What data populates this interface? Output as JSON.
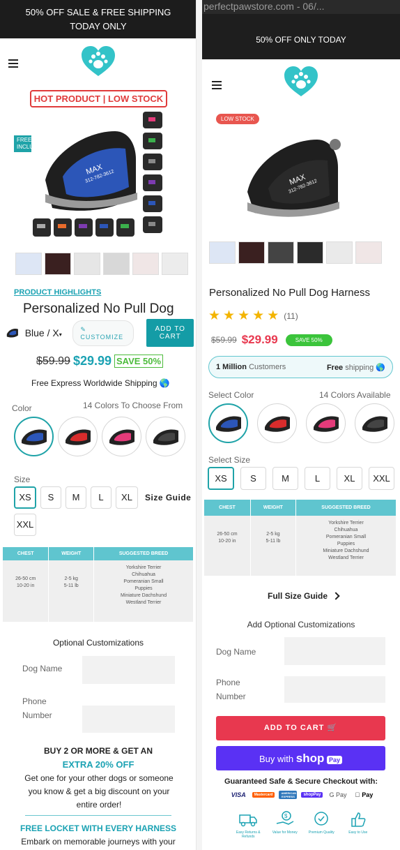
{
  "left": {
    "banner": "50% OFF SALE & FREE SHIPPING TODAY ONLY",
    "hot_label": "HOT PRODUCT | LOW STOCK",
    "free_item": "FREE ITEM INCLUDED",
    "product_highlights": "PRODUCT HIGHLIGHTS",
    "title": "Personalized No Pull Dog",
    "variant_select": "Blue / X",
    "customize": "CUSTOMIZE",
    "add_to_cart": "ADD TO CART",
    "price_old": "$59.99",
    "price_new": "$29.99",
    "save": "SAVE 50%",
    "shipping": "Free Express Worldwide Shipping",
    "color_label": "Color",
    "colors_note": "14 Colors To Choose From",
    "size_label": "Size",
    "sizes": [
      "XS",
      "S",
      "M",
      "L",
      "XL"
    ],
    "size_guide": "Size Guide",
    "size_extra": "XXL",
    "table": {
      "headers": [
        "CHEST",
        "WEIGHT",
        "SUGGESTED BREED"
      ],
      "chest": [
        "26-50 cm",
        "10-20 in"
      ],
      "weight": [
        "2-5 kg",
        "5-11 lb"
      ],
      "breeds": [
        "Yorkshire Terrier",
        "Chihuahua",
        "Pomeranian Small",
        "Puppies",
        "Miniature Dachshund",
        "Westland Terrier"
      ]
    },
    "optional_title": "Optional Customizations",
    "dog_name": "Dog Name",
    "phone_number": "Phone Number",
    "promo_title": "BUY 2 OR MORE & GET AN",
    "promo_highlight": "EXTRA 20% OFF",
    "promo_text": "Get one for your other dogs or someone you know & get a big discount on your entire order!",
    "locket_title": "FREE LOCKET WITH EVERY HARNESS",
    "locket_text": "Embark on memorable journeys with your"
  },
  "right": {
    "url_bar": "perfectpawstore.com - 06/...",
    "banner": "50% OFF ONLY TODAY",
    "low_stock": "LOW STOCK",
    "title": "Personalized No Pull Dog Harness",
    "reviews": "(11)",
    "price_old": "$59.99",
    "price_new": "$29.99",
    "save": "SAVE 50%",
    "customers_bold": "1 Million",
    "customers": "Customers",
    "free_bold": "Free",
    "shipping": "shipping",
    "select_color": "Select Color",
    "colors_available": "14 Colors Available",
    "select_size": "Select Size",
    "sizes": [
      "XS",
      "S",
      "M",
      "L",
      "XL",
      "XXL"
    ],
    "table": {
      "headers": [
        "CHEST",
        "WEIGHT",
        "SUGGESTED BREED"
      ],
      "chest": [
        "26-50 cm",
        "10-20 in"
      ],
      "weight": [
        "2-5 kg",
        "5-11 lb"
      ],
      "breeds": [
        "Yorkshire Terrier",
        "Chihuahua",
        "Pomeranian Small",
        "Puppies",
        "Miniature Dachshund",
        "Westland Terrier"
      ]
    },
    "full_size_guide": "Full Size Guide",
    "add_optional": "Add Optional Customizations",
    "dog_name": "Dog Name",
    "phone_number": "Phone Number",
    "add_to_cart": "ADD TO CART",
    "buy_with": "Buy with",
    "shop": "shop",
    "pay": "Pay",
    "guaranteed": "Guaranteed Safe & Secure Checkout with:",
    "payments": [
      "VISA",
      "Mastercard",
      "AMERICAN EXPRESS",
      "shopPay",
      "G Pay",
      "Pay"
    ],
    "trust": [
      "Easy Returns & Refunds",
      "Value for Money",
      "Premium Quality",
      "Easy to Use"
    ]
  },
  "colors": {
    "teal": "#1fa3a8",
    "banner": "#1c1c1c",
    "red": "#e8384f",
    "shop_purple": "#5a31f4",
    "save_green": "#4cbb3b"
  }
}
